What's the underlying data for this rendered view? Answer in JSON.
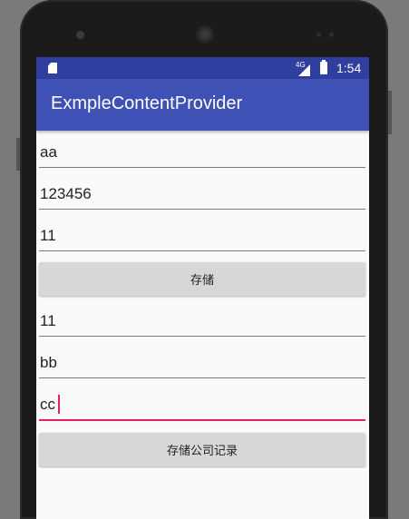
{
  "statusbar": {
    "network_label": "4G",
    "time": "1:54",
    "icons": [
      "sd-card-icon",
      "signal-icon",
      "battery-icon"
    ]
  },
  "appbar": {
    "title": "ExmpleContentProvider"
  },
  "form": {
    "field1_value": "aa",
    "field2_value": "123456",
    "field3_value": "11",
    "store_button_label": "存储",
    "field4_value": "11",
    "field5_value": "bb",
    "field6_value": "cc",
    "store_company_button_label": "存储公司记录"
  },
  "colors": {
    "primary": "#3f51b5",
    "primary_dark": "#303f9f",
    "accent": "#e91e63"
  }
}
